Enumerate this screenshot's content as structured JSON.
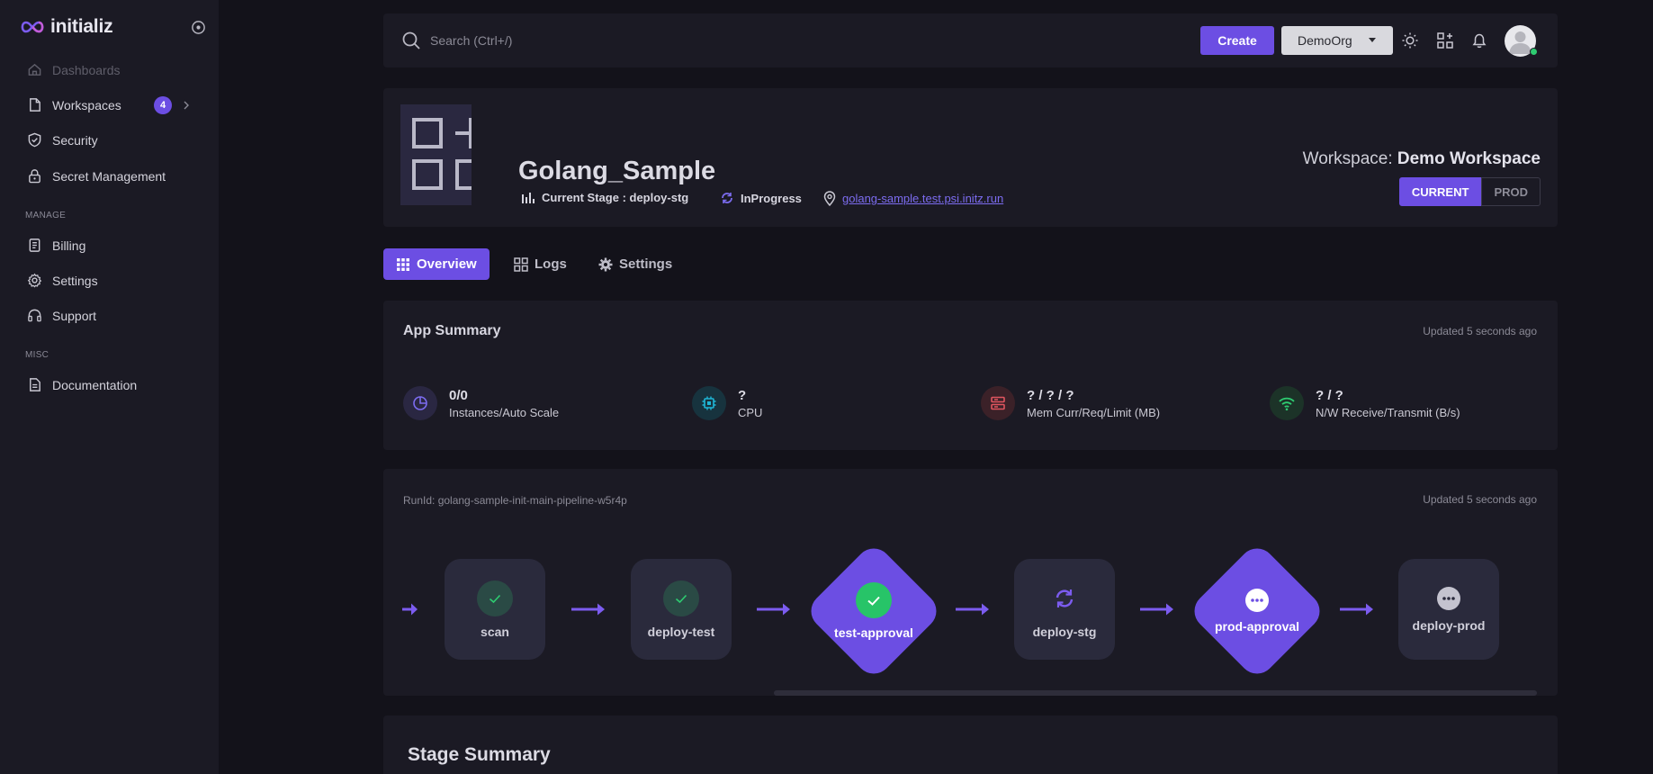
{
  "brand": {
    "name": "initializ"
  },
  "sidebar": {
    "items": [
      {
        "label": "Dashboards",
        "icon": "home-icon"
      },
      {
        "label": "Workspaces",
        "icon": "file-icon",
        "badge": "4"
      },
      {
        "label": "Security",
        "icon": "shield-icon"
      },
      {
        "label": "Secret Management",
        "icon": "lock-icon"
      }
    ],
    "manage_label": "MANAGE",
    "manage_items": [
      {
        "label": "Billing",
        "icon": "receipt-icon"
      },
      {
        "label": "Settings",
        "icon": "gear-icon"
      },
      {
        "label": "Support",
        "icon": "headset-icon"
      }
    ],
    "misc_label": "MISC",
    "misc_items": [
      {
        "label": "Documentation",
        "icon": "document-icon"
      }
    ]
  },
  "header": {
    "search_placeholder": "Search (Ctrl+/)",
    "create_label": "Create",
    "org_label": "DemoOrg"
  },
  "app": {
    "name": "Golang_Sample",
    "current_stage": "Current Stage : deploy-stg",
    "status": "InProgress",
    "url": "golang-sample.test.psi.initz.run",
    "workspace_prefix": "Workspace:",
    "workspace_name": "Demo Workspace",
    "env_current": "CURRENT",
    "env_prod": "PROD"
  },
  "tabs": {
    "overview": "Overview",
    "logs": "Logs",
    "settings": "Settings"
  },
  "summary": {
    "title": "App Summary",
    "updated": "Updated 5 seconds ago",
    "metrics": [
      {
        "value": "0/0",
        "label": "Instances/Auto Scale",
        "color": "#7c6cf0"
      },
      {
        "value": "?",
        "label": "CPU",
        "color": "#1fb6d6"
      },
      {
        "value": "? / ? / ?",
        "label": "Mem Curr/Req/Limit (MB)",
        "color": "#e0555f"
      },
      {
        "value": "? / ?",
        "label": "N/W Receive/Transmit (B/s)",
        "color": "#2ecc71"
      }
    ]
  },
  "pipeline": {
    "runid": "RunId: golang-sample-init-main-pipeline-w5r4p",
    "updated": "Updated 5 seconds ago",
    "stages": [
      {
        "name": "scan",
        "status": "success"
      },
      {
        "name": "deploy-test",
        "status": "success"
      },
      {
        "name": "test-approval",
        "status": "approved"
      },
      {
        "name": "deploy-stg",
        "status": "in-progress"
      },
      {
        "name": "prod-approval",
        "status": "pending"
      },
      {
        "name": "deploy-prod",
        "status": "pending"
      }
    ]
  },
  "stage_summary": {
    "title": "Stage Summary"
  }
}
